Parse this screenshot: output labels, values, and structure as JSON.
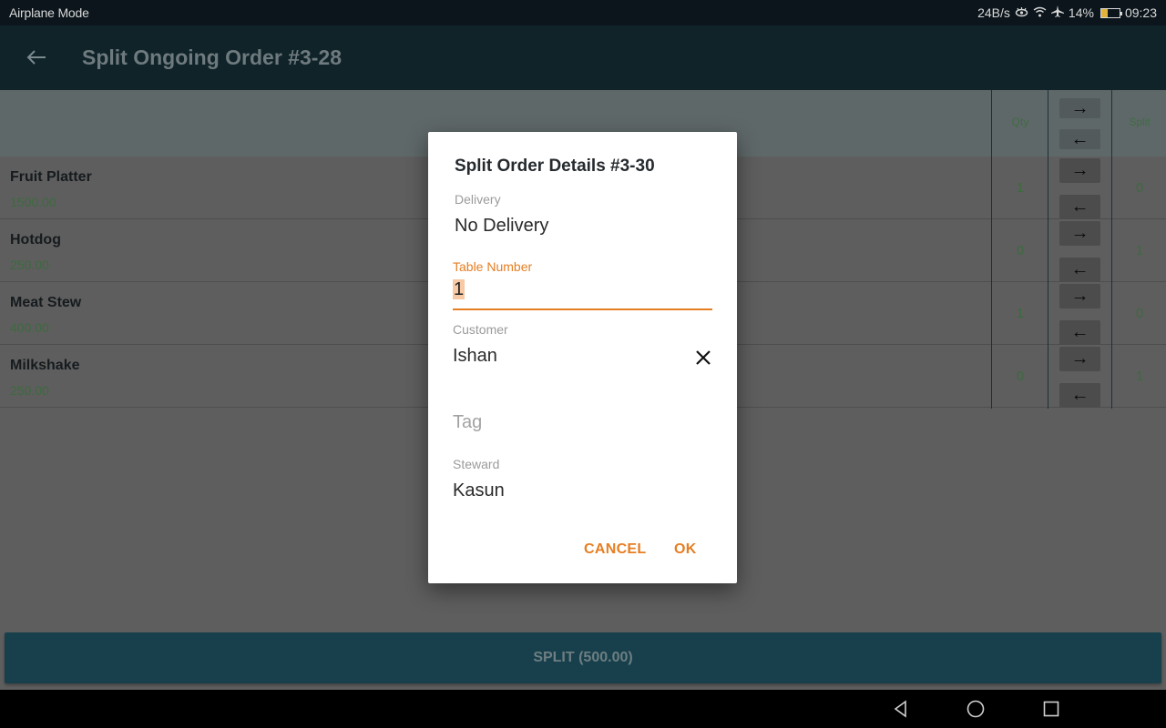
{
  "status_bar": {
    "left_text": "Airplane Mode",
    "net_speed": "24B/s",
    "icons": [
      "eye-comfort-icon",
      "wifi-icon",
      "airplane-icon"
    ],
    "battery_percent": "14%",
    "time": "09:23"
  },
  "app_bar": {
    "back_icon": "arrow-left",
    "title": "Split Ongoing Order #3-28"
  },
  "table": {
    "headers": {
      "qty": "Qty",
      "split": "Split"
    },
    "move_all_right_icon": "→",
    "move_all_left_icon": "←",
    "rows": [
      {
        "name": "Fruit Platter",
        "price": "1500.00",
        "qty": "1",
        "split": "0"
      },
      {
        "name": "Hotdog",
        "price": "250.00",
        "qty": "0",
        "split": "1"
      },
      {
        "name": "Meat Stew",
        "price": "400.00",
        "qty": "1",
        "split": "0"
      },
      {
        "name": "Milkshake",
        "price": "250.00",
        "qty": "0",
        "split": "1"
      }
    ],
    "row_right_icon": "→",
    "row_left_icon": "←"
  },
  "split_button": {
    "label": "SPLIT (500.00)"
  },
  "dialog": {
    "title": "Split Order Details #3-30",
    "delivery": {
      "label": "Delivery",
      "value": "No Delivery"
    },
    "table_number": {
      "label": "Table Number",
      "value": "1"
    },
    "customer": {
      "label": "Customer",
      "value": "Ishan",
      "clear_icon": "close-icon"
    },
    "tag": {
      "placeholder": "Tag"
    },
    "steward": {
      "label": "Steward",
      "value": "Kasun"
    },
    "cancel_label": "CANCEL",
    "ok_label": "OK"
  },
  "colors": {
    "accent": "#e67e22",
    "app_bar": "#0f2329",
    "split_bar": "#17404c",
    "price_green": "#3d6a3f"
  },
  "nav_bar": {
    "icons": [
      "back-triangle-icon",
      "home-circle-icon",
      "recents-square-icon"
    ]
  }
}
